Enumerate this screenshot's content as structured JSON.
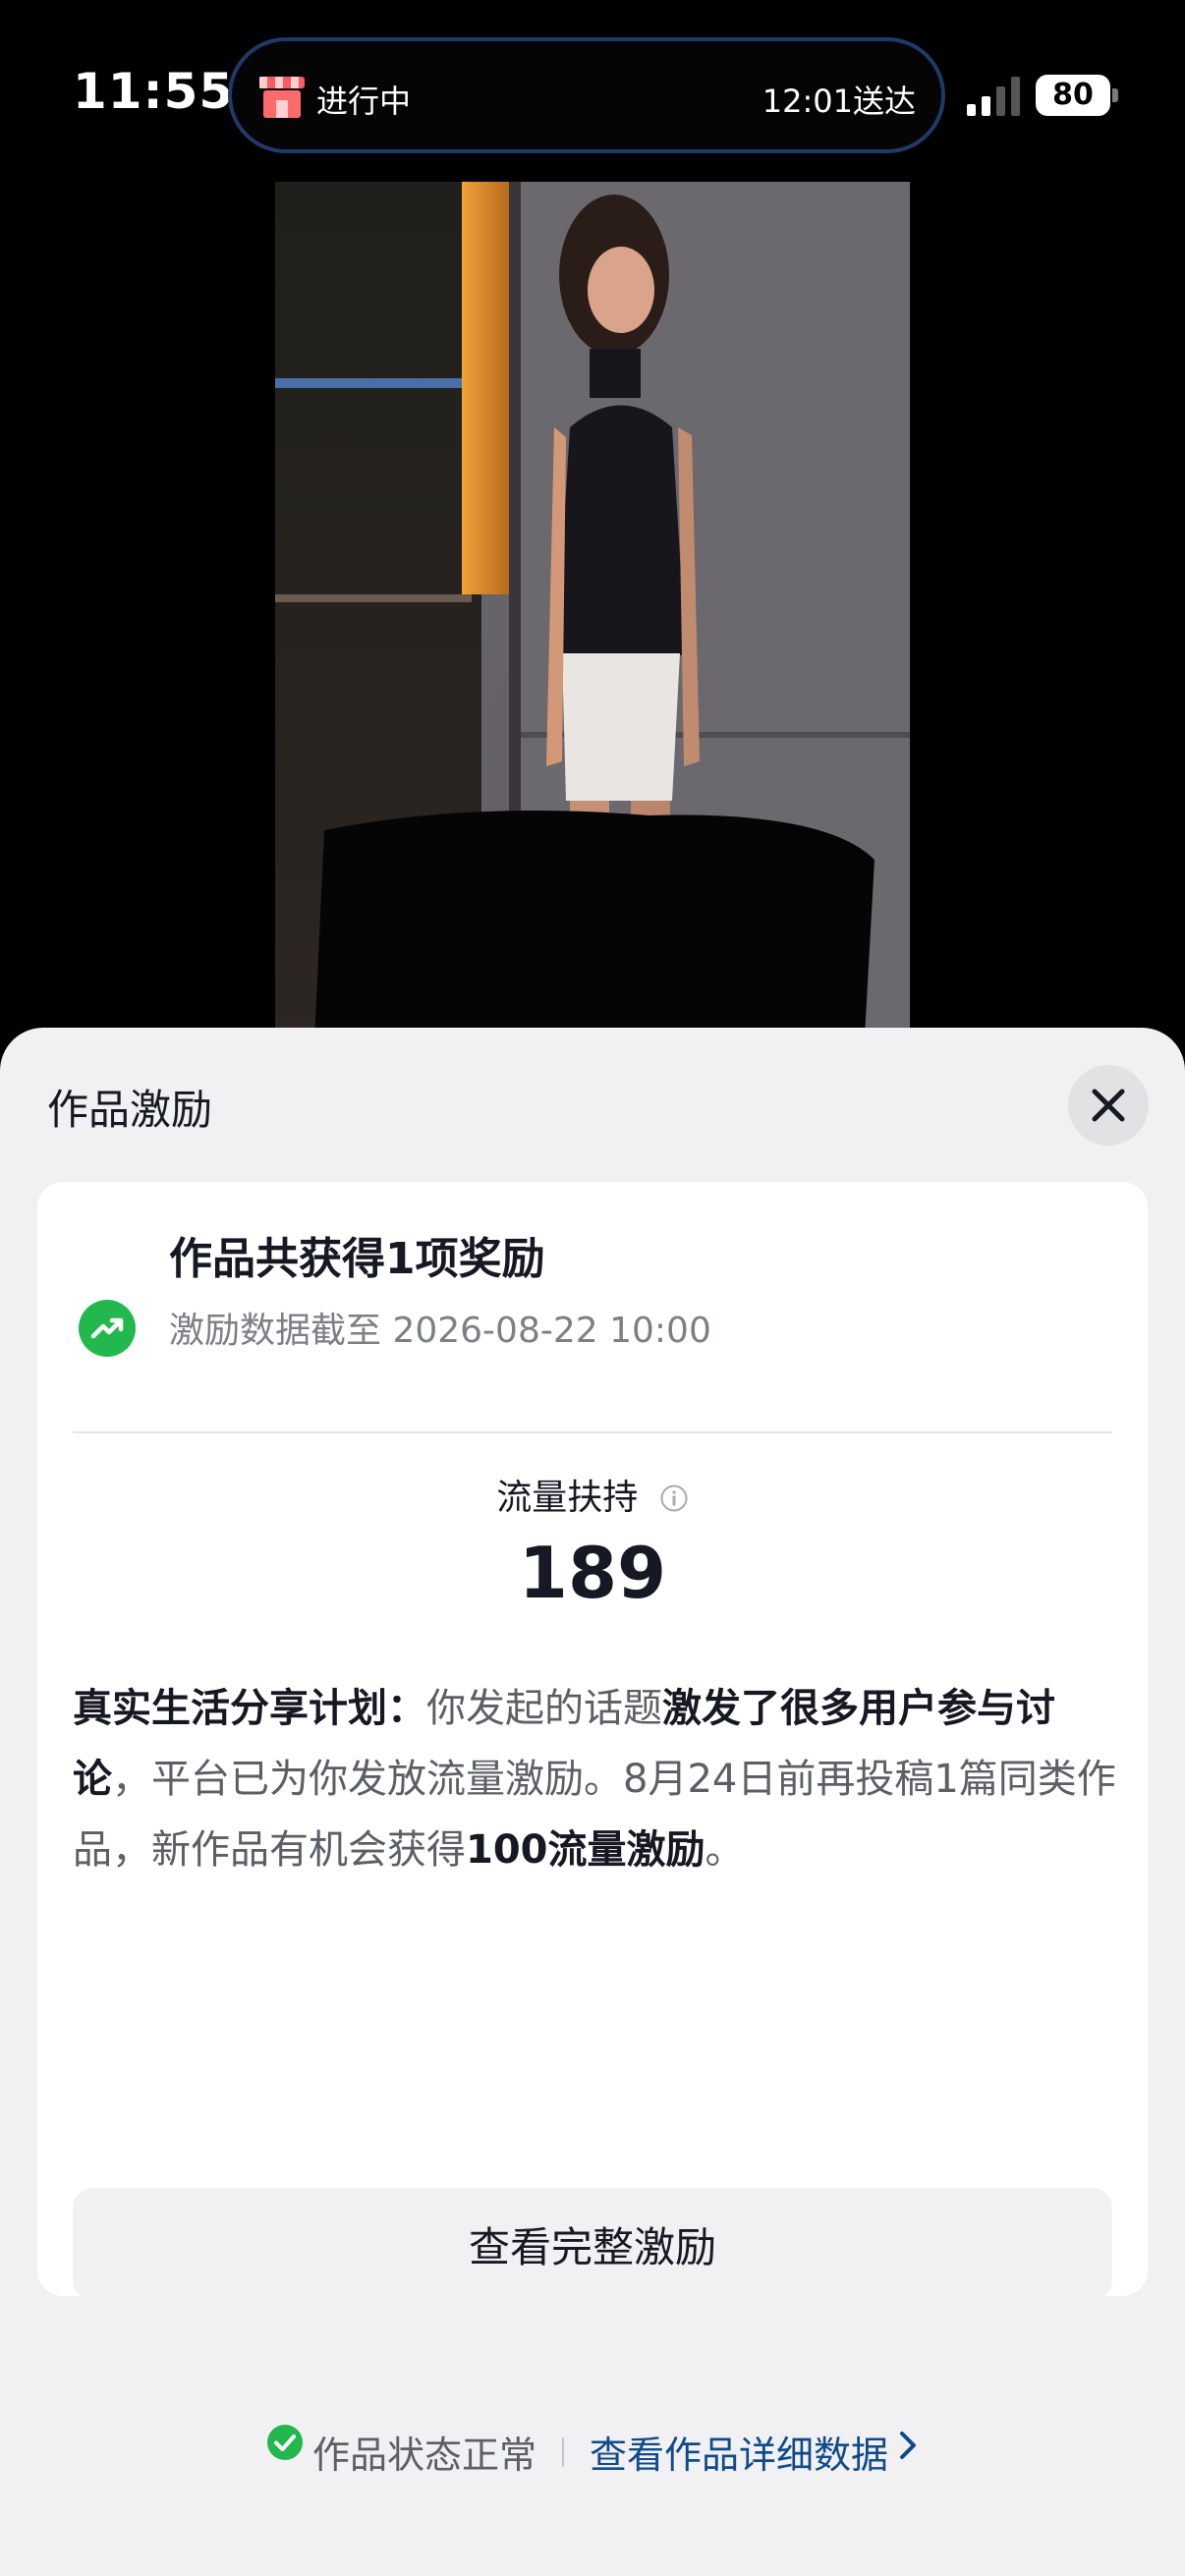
{
  "status_bar": {
    "time": "11:55",
    "activity_status": "进行中",
    "activity_eta": "12:01送达",
    "battery_level": "80",
    "signal_bars_active": 2,
    "signal_bars_total": 4
  },
  "sheet": {
    "title": "作品激励"
  },
  "reward_card": {
    "headline": "作品共获得1项奖励",
    "data_as_of": "激励数据截至 2026-08-22 10:00",
    "metric_label": "流量扶持",
    "metric_value": "189",
    "desc_bold_1": "真实生活分享计划：",
    "desc_plain_1": "你发起的话题",
    "desc_bold_2": "激发了很多用户参与讨论",
    "desc_plain_2": "，平台已为你发放流量激励。8月24日前再投稿1篇同类作品，新作品有机会获得",
    "desc_bold_3": "100",
    "desc_bold_4": "流量激励",
    "desc_plain_3": "。",
    "button_label": "查看完整激励"
  },
  "footer": {
    "status_text": "作品状态正常",
    "detail_link": "查看作品详细数据"
  },
  "colors": {
    "accent_green": "#22b84d",
    "link_blue": "#0f4a8a",
    "island_border": "#1f3a6a"
  },
  "icons": [
    "store-icon",
    "signal-icon",
    "close-icon",
    "trend-up-icon",
    "info-icon",
    "check-circle-icon",
    "chevron-right-icon"
  ]
}
